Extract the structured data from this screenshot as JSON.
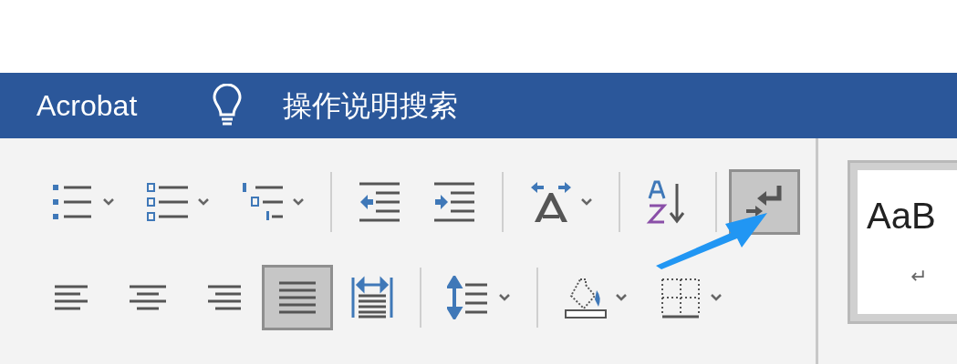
{
  "title_bar": {
    "tab": "Acrobat",
    "search_label": "操作说明搜索"
  },
  "paragraph_rows": [
    {
      "groups": [
        {
          "buttons": [
            {
              "kind": "bullets",
              "dropdown": true,
              "selected": false
            },
            {
              "kind": "numbering",
              "dropdown": true,
              "selected": false
            },
            {
              "kind": "multilevel",
              "dropdown": true,
              "selected": false
            }
          ]
        },
        {
          "buttons": [
            {
              "kind": "outdent",
              "dropdown": false,
              "selected": false
            },
            {
              "kind": "indent",
              "dropdown": false,
              "selected": false
            }
          ]
        },
        {
          "buttons": [
            {
              "kind": "text-direction",
              "dropdown": true,
              "selected": false
            }
          ]
        },
        {
          "buttons": [
            {
              "kind": "sort",
              "dropdown": false,
              "selected": false
            }
          ]
        },
        {
          "buttons": [
            {
              "kind": "show-marks",
              "dropdown": false,
              "selected": true
            }
          ]
        }
      ]
    },
    {
      "groups": [
        {
          "buttons": [
            {
              "kind": "align-left",
              "dropdown": false,
              "selected": false
            },
            {
              "kind": "align-center",
              "dropdown": false,
              "selected": false
            },
            {
              "kind": "align-right",
              "dropdown": false,
              "selected": false
            },
            {
              "kind": "justify",
              "dropdown": false,
              "selected": true
            },
            {
              "kind": "distribute",
              "dropdown": false,
              "selected": false
            }
          ]
        },
        {
          "buttons": [
            {
              "kind": "line-spacing",
              "dropdown": true,
              "selected": false
            }
          ]
        },
        {
          "buttons": [
            {
              "kind": "shading",
              "dropdown": true,
              "selected": false
            },
            {
              "kind": "borders",
              "dropdown": true,
              "selected": false
            }
          ]
        }
      ]
    }
  ],
  "styles_gallery": {
    "preview": "AaB",
    "mark": "↵"
  }
}
